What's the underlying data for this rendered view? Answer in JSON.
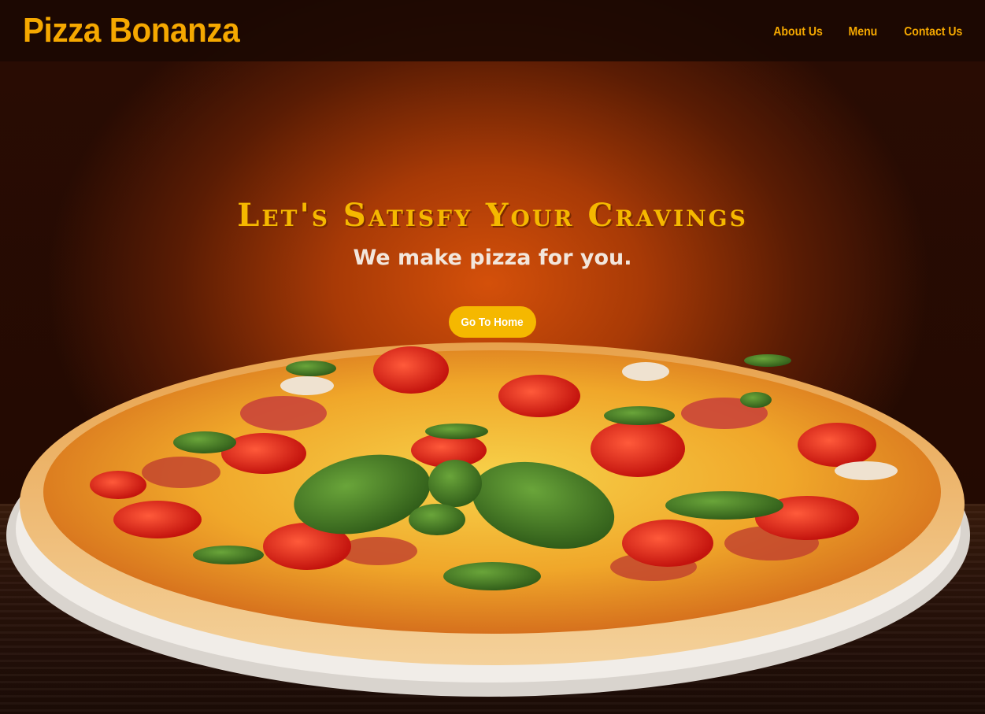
{
  "brand": {
    "name": "Pizza Bonanza"
  },
  "nav": {
    "links": [
      {
        "label": "About Us"
      },
      {
        "label": "Menu"
      },
      {
        "label": "Contact Us"
      }
    ]
  },
  "hero": {
    "title": "Let's Satisfy Your Cravings",
    "subtitle": "We make pizza for you.",
    "cta_label": "Go To Home"
  },
  "colors": {
    "accent": "#f5b800",
    "nav_bg": "#1a0802",
    "hero_glow": "#d4500a"
  },
  "images": {
    "hero_background": "pizza-photo"
  }
}
